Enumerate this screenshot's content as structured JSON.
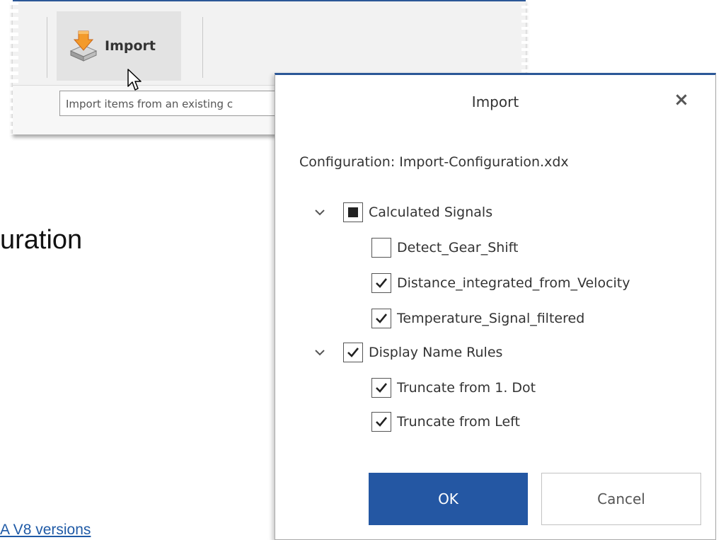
{
  "background": {
    "fragment_text": "uration",
    "link_text": "A V8 versions"
  },
  "ribbon": {
    "import_label": "Import",
    "tooltip": "Import items from an existing c"
  },
  "dialog": {
    "title": "Import",
    "close_glyph": "×",
    "configuration_label": "Configuration: Import-Configuration.xdx",
    "tree": [
      {
        "label": "Calculated Signals",
        "state": "indeterminate",
        "expanded": true,
        "children": [
          {
            "label": "Detect_Gear_Shift",
            "state": "unchecked"
          },
          {
            "label": "Distance_integrated_from_Velocity",
            "state": "checked"
          },
          {
            "label": "Temperature_Signal_filtered",
            "state": "checked"
          }
        ]
      },
      {
        "label": "Display Name Rules",
        "state": "checked",
        "expanded": true,
        "children": [
          {
            "label": "Truncate from 1. Dot",
            "state": "checked"
          },
          {
            "label": "Truncate from Left",
            "state": "checked"
          }
        ]
      }
    ],
    "ok_label": "OK",
    "cancel_label": "Cancel"
  },
  "colors": {
    "accent": "#2457a3",
    "ribbon_border": "#2b5797",
    "link": "#1f5aa6"
  },
  "icons": {
    "import": "import-arrow-tray-icon",
    "cursor": "mouse-pointer-icon",
    "close": "close-icon",
    "expander": "chevron-down-icon",
    "checkmark": "checkmark-icon"
  }
}
